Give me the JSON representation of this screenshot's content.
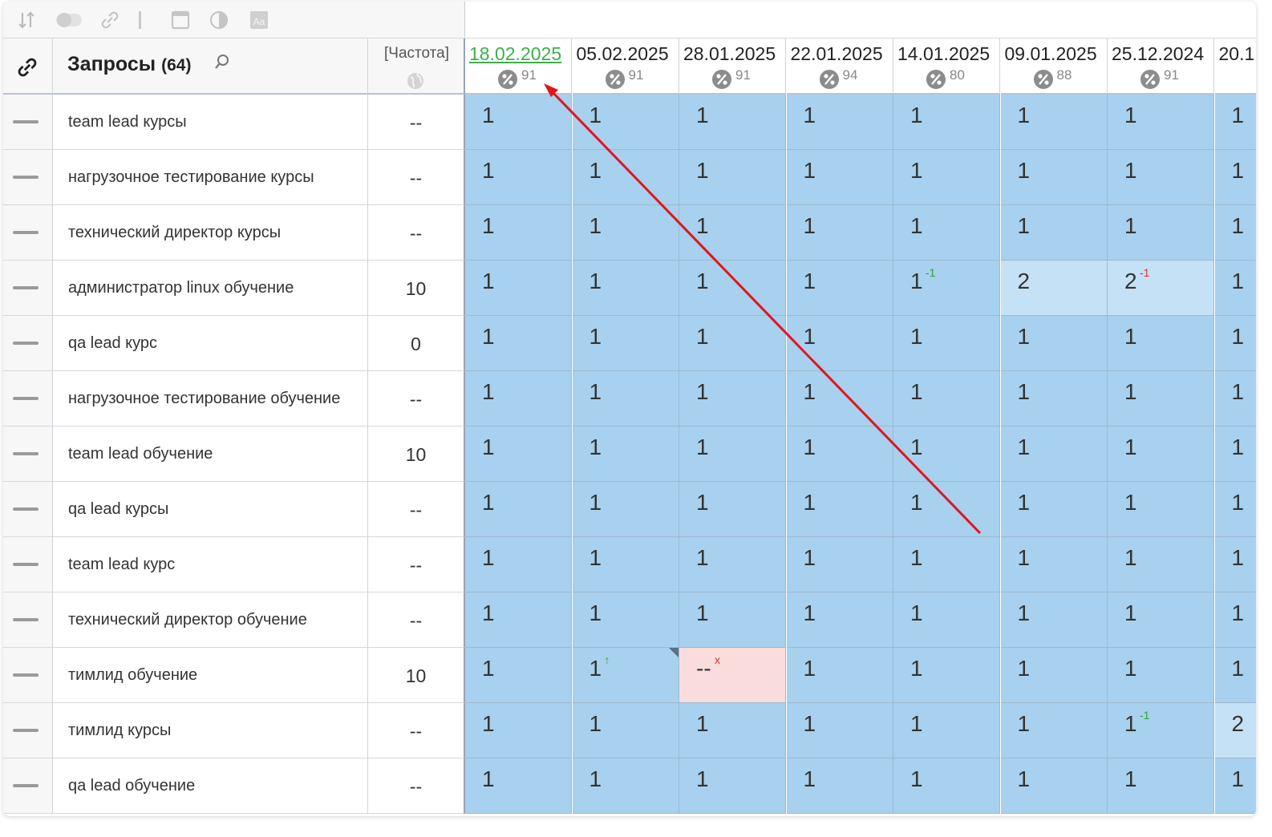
{
  "toolbar": {
    "icons": [
      "sort-icon",
      "toggle-icon",
      "link-icon",
      "separator",
      "window-icon",
      "contrast-icon",
      "font-icon"
    ]
  },
  "header": {
    "link_icon": "link-icon",
    "queries_title": "Запросы",
    "queries_count": "(64)",
    "frequency_label": "[Частота]",
    "frequency_icon": "globe-icon",
    "dates": [
      {
        "date": "18.02.2025",
        "pct": "91",
        "active": true
      },
      {
        "date": "05.02.2025",
        "pct": "91"
      },
      {
        "date": "28.01.2025",
        "pct": "91"
      },
      {
        "date": "22.01.2025",
        "pct": "94"
      },
      {
        "date": "14.01.2025",
        "pct": "80"
      },
      {
        "date": "09.01.2025",
        "pct": "88"
      },
      {
        "date": "25.12.2024",
        "pct": "91"
      },
      {
        "date": "20.1",
        "pct": ""
      }
    ]
  },
  "rows": [
    {
      "query": "team lead курсы",
      "freq": "--",
      "pos": [
        "1",
        "1",
        "1",
        "1",
        "1",
        "1",
        "1",
        "1"
      ]
    },
    {
      "query": "нагрузочное тестирование курсы",
      "freq": "--",
      "pos": [
        "1",
        "1",
        "1",
        "1",
        "1",
        "1",
        "1",
        "1"
      ]
    },
    {
      "query": "технический директор курсы",
      "freq": "--",
      "pos": [
        "1",
        "1",
        "1",
        "1",
        "1",
        "1",
        "1",
        "1"
      ]
    },
    {
      "query": "администратор linux обучение",
      "freq": "10",
      "pos": [
        "1",
        "1",
        "1",
        "1",
        "1",
        "2",
        "2",
        "1"
      ],
      "changes": {
        "4": {
          "text": "-1",
          "dir": "up"
        },
        "6": {
          "text": "-1",
          "dir": "down"
        }
      }
    },
    {
      "query": "qa lead курс",
      "freq": "0",
      "pos": [
        "1",
        "1",
        "1",
        "1",
        "1",
        "1",
        "1",
        "1"
      ]
    },
    {
      "query": "нагрузочное тестирование обучение",
      "freq": "--",
      "pos": [
        "1",
        "1",
        "1",
        "1",
        "1",
        "1",
        "1",
        "1"
      ]
    },
    {
      "query": "team lead обучение",
      "freq": "10",
      "pos": [
        "1",
        "1",
        "1",
        "1",
        "1",
        "1",
        "1",
        "1"
      ]
    },
    {
      "query": "qa lead курсы",
      "freq": "--",
      "pos": [
        "1",
        "1",
        "1",
        "1",
        "1",
        "1",
        "1",
        "1"
      ]
    },
    {
      "query": "team lead курс",
      "freq": "--",
      "pos": [
        "1",
        "1",
        "1",
        "1",
        "1",
        "1",
        "1",
        "1"
      ]
    },
    {
      "query": "технический директор обучение",
      "freq": "--",
      "pos": [
        "1",
        "1",
        "1",
        "1",
        "1",
        "1",
        "1",
        "1"
      ]
    },
    {
      "query": "тимлид обучение",
      "freq": "10",
      "pos": [
        "1",
        "1",
        "--",
        "1",
        "1",
        "1",
        "1",
        "1"
      ],
      "changes": {
        "1": {
          "text": "↑",
          "dir": "up"
        },
        "2": {
          "text": "x",
          "dir": "down"
        }
      }
    },
    {
      "query": "тимлид курсы",
      "freq": "--",
      "pos": [
        "1",
        "1",
        "1",
        "1",
        "1",
        "1",
        "1",
        "2"
      ],
      "changes": {
        "6": {
          "text": "-1",
          "dir": "up"
        }
      }
    },
    {
      "query": "qa lead обучение",
      "freq": "--",
      "pos": [
        "1",
        "1",
        "1",
        "1",
        "1",
        "1",
        "1",
        "1"
      ]
    }
  ],
  "colors": {
    "position_cell": "#a7d1ee",
    "position_cell_light": "#c5e1f5",
    "missing_cell": "#f9dcdc",
    "active_date": "#3db04a",
    "arrow": "#e3141c"
  }
}
